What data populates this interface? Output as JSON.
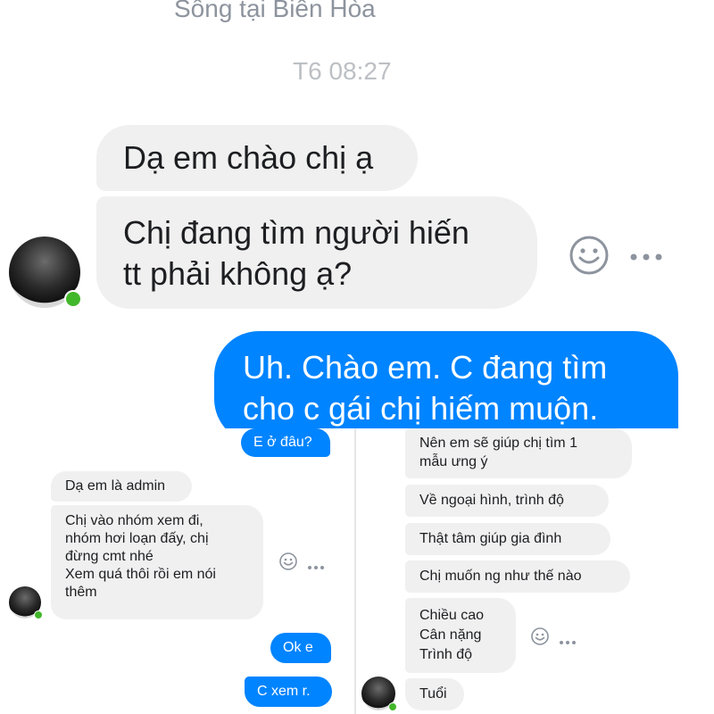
{
  "top": {
    "header_text": "Sống tại Biên Hòa",
    "timestamp": "T6 08:27",
    "messages_in": [
      "Dạ em chào chị ạ",
      "Chị đang tìm người hiến\ntt phải không ạ?"
    ],
    "message_out": "Uh. Chào em. C đang tìm\ncho c gái chị hiếm muộn."
  },
  "left": {
    "out_1": "E ở đâu?",
    "in_1": "Dạ em là admin",
    "in_2": "Chị vào nhóm xem đi,\nnhóm hơi loạn đấy, chị\nđừng cmt nhé\nXem quá thôi rồi em nói\nthêm",
    "out_2": "Ok e",
    "out_3": "C xem r."
  },
  "right": {
    "in_1": "Nên em sẽ giúp chị tìm 1\nmẫu ưng ý",
    "in_2": "Về ngoại hình, trình độ",
    "in_3": "Thật tâm giúp gia đình",
    "in_4": "Chị muốn ng như thế nào",
    "in_5": "Chiều cao\nCân nặng\nTrình độ",
    "in_6": "Tuổi"
  },
  "icons": {
    "emoji": "smiley-face-icon",
    "more": "more-dots-icon"
  },
  "colors": {
    "outgoing": "#0084ff",
    "incoming": "#f1f0f0",
    "online": "#42b72a",
    "muted_text": "#8d949e"
  }
}
